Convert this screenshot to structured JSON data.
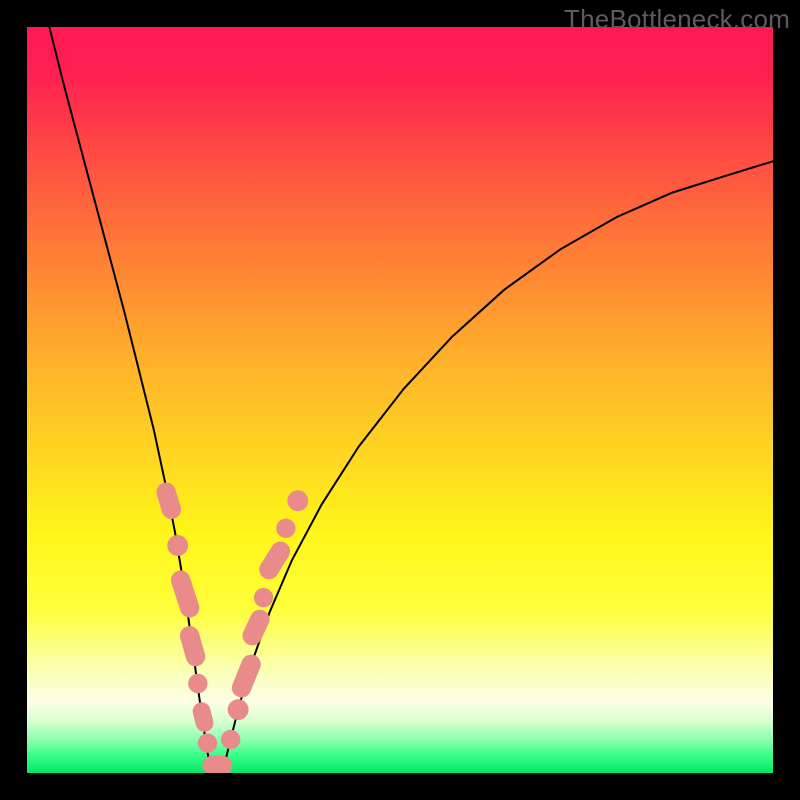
{
  "watermark": "TheBottleneck.com",
  "chart_data": {
    "type": "line",
    "title": "",
    "xlabel": "",
    "ylabel": "",
    "xlim": [
      0,
      100
    ],
    "ylim": [
      0,
      100
    ],
    "background_gradient": {
      "stops": [
        {
          "offset": 0.0,
          "color": "#ff1a55"
        },
        {
          "offset": 0.06,
          "color": "#ff1f51"
        },
        {
          "offset": 0.25,
          "color": "#ff6a3a"
        },
        {
          "offset": 0.45,
          "color": "#ffb22a"
        },
        {
          "offset": 0.68,
          "color": "#fff61a"
        },
        {
          "offset": 0.78,
          "color": "#ffff3a"
        },
        {
          "offset": 0.86,
          "color": "#faffb0"
        },
        {
          "offset": 0.905,
          "color": "#fcffe8"
        },
        {
          "offset": 0.93,
          "color": "#d9ffd0"
        },
        {
          "offset": 0.955,
          "color": "#8fffb0"
        },
        {
          "offset": 0.975,
          "color": "#3cff8a"
        },
        {
          "offset": 1.0,
          "color": "#00e865"
        }
      ]
    },
    "series": [
      {
        "name": "left-branch",
        "color": "#000000",
        "width": 2,
        "x": [
          3.0,
          5.0,
          7.0,
          9.0,
          11.0,
          13.0,
          15.0,
          17.0,
          18.5,
          19.8,
          20.8,
          21.6,
          22.3,
          22.9,
          23.4,
          23.8,
          24.1,
          24.35,
          24.55,
          24.7,
          24.8
        ],
        "y": [
          100,
          92,
          84.5,
          77,
          69.5,
          62,
          54,
          46,
          39,
          32.5,
          26.5,
          21,
          16,
          11.5,
          8,
          5.3,
          3.3,
          1.9,
          1.0,
          0.4,
          0.1
        ]
      },
      {
        "name": "right-branch",
        "color": "#000000",
        "width": 2,
        "x": [
          26.2,
          26.3,
          26.5,
          26.8,
          27.3,
          28.0,
          29.0,
          30.5,
          32.5,
          35.5,
          39.5,
          44.5,
          50.5,
          57.0,
          64.0,
          71.5,
          79.0,
          86.5,
          93.5,
          100.0
        ],
        "y": [
          0.1,
          0.4,
          1.2,
          2.5,
          4.5,
          7.3,
          11.0,
          15.8,
          21.5,
          28.5,
          36.0,
          43.8,
          51.5,
          58.5,
          64.8,
          70.2,
          74.5,
          77.8,
          80.0,
          82.0
        ]
      }
    ],
    "valley_floor": {
      "x": [
        24.8,
        26.2
      ],
      "y": [
        0.05,
        0.05
      ],
      "color": "#000000",
      "width": 2
    },
    "markers": {
      "color": "#e98b8b",
      "stroke": "#e98b8b",
      "points": [
        {
          "type": "capsule",
          "cx": 19.0,
          "cy": 36.5,
          "len": 5.0,
          "w": 2.6,
          "angle": -73
        },
        {
          "type": "dot",
          "cx": 20.2,
          "cy": 30.5,
          "r": 1.4
        },
        {
          "type": "capsule",
          "cx": 21.2,
          "cy": 24.0,
          "len": 6.5,
          "w": 2.6,
          "angle": -72
        },
        {
          "type": "capsule",
          "cx": 22.2,
          "cy": 17.0,
          "len": 5.5,
          "w": 2.6,
          "angle": -74
        },
        {
          "type": "dot",
          "cx": 22.9,
          "cy": 12.0,
          "r": 1.3
        },
        {
          "type": "capsule",
          "cx": 23.6,
          "cy": 7.5,
          "len": 4.0,
          "w": 2.4,
          "angle": -76
        },
        {
          "type": "dot",
          "cx": 24.2,
          "cy": 4.0,
          "r": 1.3
        },
        {
          "type": "capsule",
          "cx": 25.5,
          "cy": 1.0,
          "len": 4.0,
          "w": 2.6,
          "angle": 0
        },
        {
          "type": "dot",
          "cx": 27.3,
          "cy": 4.5,
          "r": 1.3
        },
        {
          "type": "dot",
          "cx": 28.3,
          "cy": 8.5,
          "r": 1.4
        },
        {
          "type": "capsule",
          "cx": 29.4,
          "cy": 13.0,
          "len": 6.0,
          "w": 2.6,
          "angle": 68
        },
        {
          "type": "capsule",
          "cx": 30.7,
          "cy": 19.5,
          "len": 5.0,
          "w": 2.6,
          "angle": 65
        },
        {
          "type": "dot",
          "cx": 31.7,
          "cy": 23.5,
          "r": 1.3
        },
        {
          "type": "capsule",
          "cx": 33.2,
          "cy": 28.5,
          "len": 5.5,
          "w": 2.6,
          "angle": 58
        },
        {
          "type": "dot",
          "cx": 34.7,
          "cy": 32.8,
          "r": 1.3
        },
        {
          "type": "dot",
          "cx": 36.3,
          "cy": 36.5,
          "r": 1.4
        }
      ]
    }
  }
}
